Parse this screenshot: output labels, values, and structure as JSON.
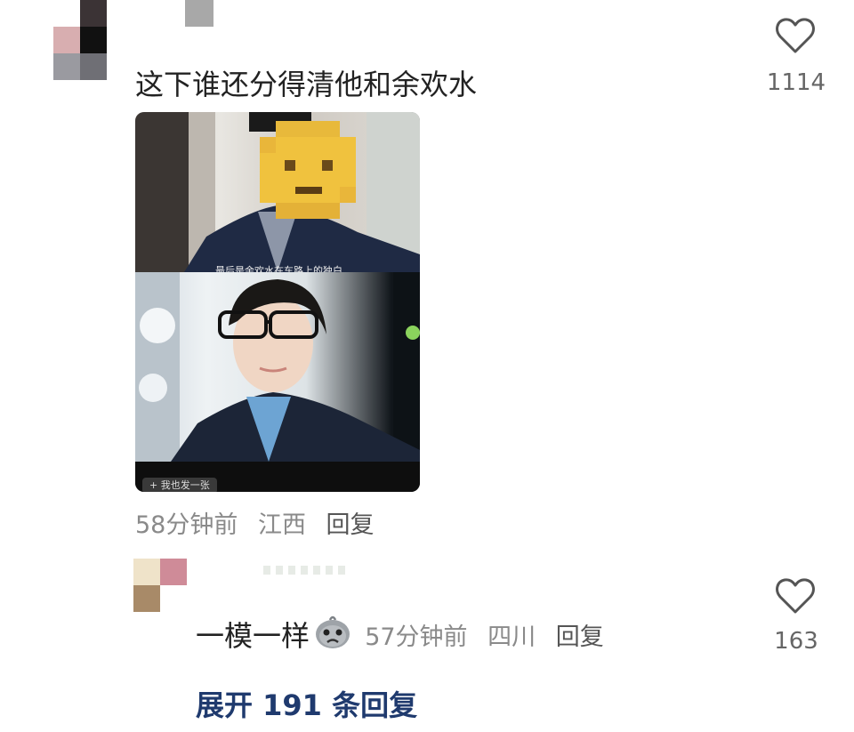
{
  "comment1": {
    "text": "这下谁还分得清他和余欢水",
    "likes": "1114",
    "time": "58分钟前",
    "location": "江西",
    "reply_label": "回复",
    "image_chip": "+ 我也发一张",
    "image_caption": "最后是余欢水在车路上的独白"
  },
  "comment2": {
    "text": "一模一样",
    "emoji_icon": "crying-face-emoji-icon",
    "likes": "163",
    "time": "57分钟前",
    "location": "四川",
    "reply_label": "回复"
  },
  "expand_label": "展开 191 条回复",
  "colors": {
    "expand_link": "#1f3a6e",
    "meta_text": "#8a8a8a",
    "heart_stroke": "#555555"
  }
}
